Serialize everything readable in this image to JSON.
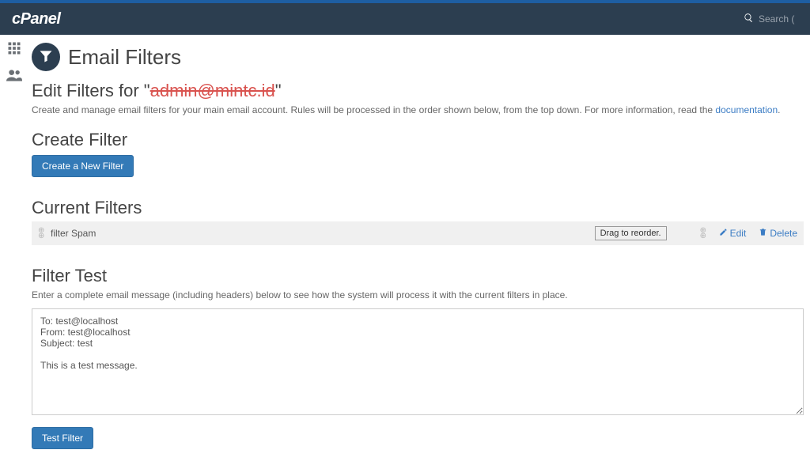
{
  "brand": "cPanel",
  "search": {
    "placeholder": "Search ("
  },
  "page_title": "Email Filters",
  "edit_filters": {
    "prefix": "Edit Filters for \"",
    "account_redacted": "admin@mintc.id",
    "suffix": "\""
  },
  "edit_desc_prefix": "Create and manage email filters for your main email account. Rules will be processed in the order shown below, from the top down. For more information, read the ",
  "edit_desc_link": "documentation",
  "edit_desc_suffix": ".",
  "create_filter": {
    "heading": "Create Filter",
    "button": "Create a New Filter"
  },
  "current_filters": {
    "heading": "Current Filters",
    "items": [
      {
        "name": "filter Spam"
      }
    ],
    "reorder_tip": "Drag to reorder.",
    "actions": {
      "edit": "Edit",
      "delete": "Delete"
    }
  },
  "filter_test": {
    "heading": "Filter Test",
    "desc": "Enter a complete email message (including headers) below to see how the system will process it with the current filters in place.",
    "content": "To: test@localhost\nFrom: test@localhost\nSubject: test\n\nThis is a test message.",
    "button": "Test Filter"
  }
}
